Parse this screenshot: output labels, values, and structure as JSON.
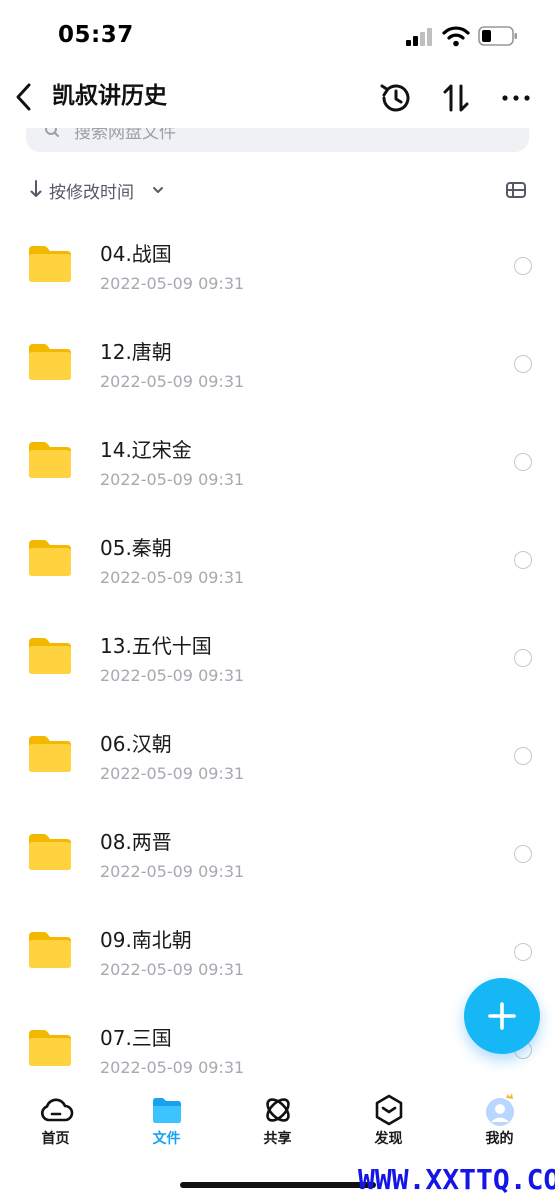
{
  "status_bar": {
    "time": "05:37"
  },
  "nav": {
    "title": "凯叔讲历史"
  },
  "search": {
    "placeholder": "搜索网盘文件"
  },
  "sort": {
    "label": "按修改时间"
  },
  "files": [
    {
      "name": "04.战国",
      "date": "2022-05-09 09:31"
    },
    {
      "name": "12.唐朝",
      "date": "2022-05-09 09:31"
    },
    {
      "name": "14.辽宋金",
      "date": "2022-05-09 09:31"
    },
    {
      "name": "05.秦朝",
      "date": "2022-05-09 09:31"
    },
    {
      "name": "13.五代十国",
      "date": "2022-05-09 09:31"
    },
    {
      "name": "06.汉朝",
      "date": "2022-05-09 09:31"
    },
    {
      "name": "08.两晋",
      "date": "2022-05-09 09:31"
    },
    {
      "name": "09.南北朝",
      "date": "2022-05-09 09:31"
    },
    {
      "name": "07.三国",
      "date": "2022-05-09 09:31"
    }
  ],
  "tabs": [
    {
      "label": "首页",
      "icon": "cloud-icon",
      "active": false
    },
    {
      "label": "文件",
      "icon": "folder-icon",
      "active": true
    },
    {
      "label": "共享",
      "icon": "share-orbit-icon",
      "active": false
    },
    {
      "label": "发现",
      "icon": "discover-icon",
      "active": false
    },
    {
      "label": "我的",
      "icon": "avatar-icon",
      "active": false
    }
  ],
  "watermark": "WWW.XXTTQ.COM",
  "colors": {
    "accent": "#16a2f0",
    "fab": "#16b7f5",
    "folder": "#ffd23f",
    "text_secondary": "#a6a9b1"
  }
}
